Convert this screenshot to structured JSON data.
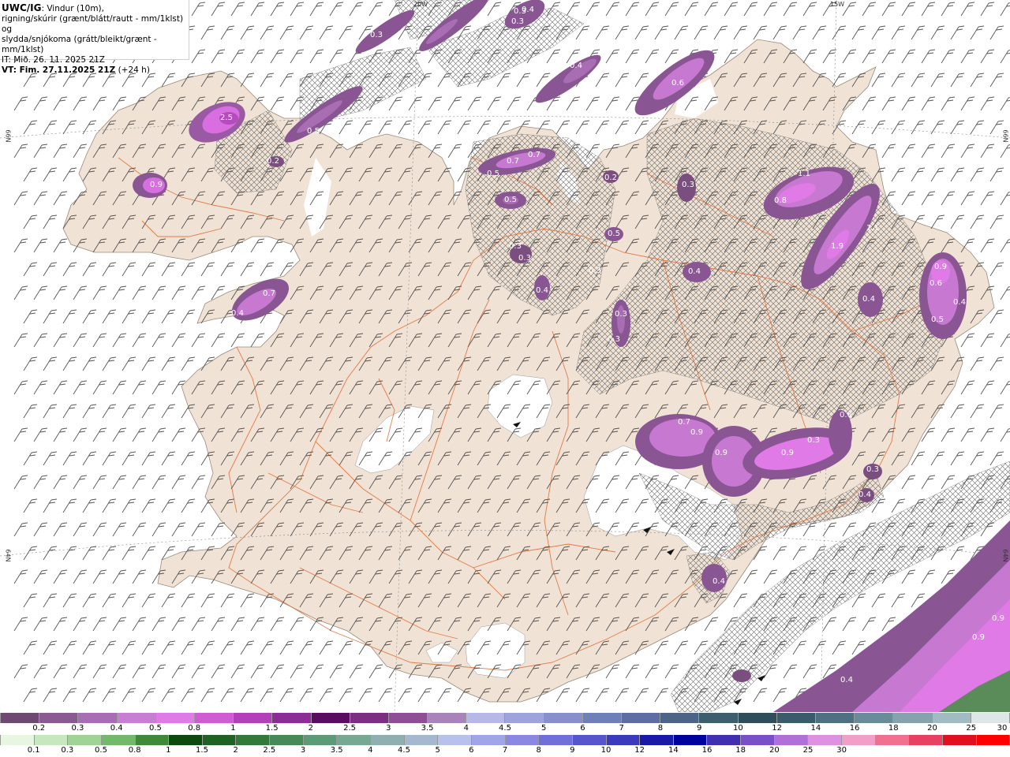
{
  "info": {
    "model": "UWC/IG",
    "line1": ": Vindur (10m),",
    "line2": "rigning/skúrir (grænt/blátt/rautt - mm/1klst) og",
    "line3": "slydda/snjókoma (grátt/bleikt/grænt - mm/1klst)",
    "init": "IT: Mið. 26. 11. 2025 21Z",
    "valid": "VT: Fim. 27.11.2025 21Z",
    "lead": "(+24 h)"
  },
  "graticule": {
    "lon_top_1": "20W",
    "lon_top_2": "15W",
    "lat_left_1": "66N",
    "lat_left_2": "64N",
    "lat_right_1": "66N",
    "lat_right_2": "64N"
  },
  "precip_values": [
    "0.3",
    "2.5",
    "0.9",
    "0.5",
    "0.2",
    "0.7",
    "0.4",
    "0.3",
    "0.3",
    "0.4",
    "0.4",
    "0.6",
    "0.5",
    "0.7",
    "0.7",
    "0.3",
    "0.5",
    "0.3",
    "0.3",
    "0.5",
    "0.2",
    "0.3",
    "0.4",
    "0.3",
    "0.3",
    "0.3",
    "1.1",
    "0.8",
    "1.1",
    "1.9",
    "0.9",
    "0.6",
    "0.4",
    "0.5",
    "0.4",
    "0.4",
    "0.6",
    "0.7",
    "0.9",
    "0.9",
    "0.9",
    "0.3",
    "0.3",
    "0.4",
    "0.4",
    "0.9",
    "0.9",
    "0.4"
  ],
  "legend_snow": {
    "colors": [
      "#6e4a72",
      "#8c5a93",
      "#a96db4",
      "#c77fd1",
      "#e07ae6",
      "#d05cd4",
      "#b43fbb",
      "#8c2c96",
      "#5a0d5f",
      "#7a2f80",
      "#8f4f96",
      "#a784ba",
      "#b8b8e8",
      "#9ea3dc",
      "#8790cc",
      "#6f7fb8",
      "#5e6ea3",
      "#4d6487",
      "#3d5e6c",
      "#2f4e5a",
      "#3a5b6a",
      "#4f7080",
      "#6a8b98",
      "#86a3ad",
      "#a2bac2",
      "#dfe6e8"
    ],
    "labels": [
      "0.2",
      "0.3",
      "0.4",
      "0.5",
      "0.8",
      "1",
      "1.5",
      "2",
      "2.5",
      "3",
      "3.5",
      "4",
      "4.5",
      "5",
      "6",
      "7",
      "8",
      "9",
      "10",
      "12",
      "14",
      "16",
      "18",
      "20",
      "25",
      "30"
    ]
  },
  "legend_rain": {
    "colors": [
      "#e6f6e0",
      "#c5e8bf",
      "#9fd496",
      "#74b86c",
      "#3f8a3a",
      "#0d4a0d",
      "#1f6224",
      "#327a3a",
      "#468a58",
      "#5d9a76",
      "#76a892",
      "#8fb0b0",
      "#a4b8d0",
      "#b8c0ec",
      "#a0a4e8",
      "#8a88e0",
      "#7070d8",
      "#5656cc",
      "#3a3abc",
      "#1a1aa8",
      "#0000a0",
      "#4030b0",
      "#7a50c8",
      "#b070d8",
      "#e090e0",
      "#f0a0c8",
      "#f07090",
      "#e84060",
      "#e01020",
      "#ff0000"
    ],
    "labels": [
      "0.1",
      "0.3",
      "0.5",
      "0.8",
      "1",
      "1.5",
      "2",
      "2.5",
      "3",
      "3.5",
      "4",
      "4.5",
      "5",
      "6",
      "7",
      "8",
      "9",
      "10",
      "12",
      "14",
      "16",
      "18",
      "20",
      "25",
      "30"
    ]
  }
}
